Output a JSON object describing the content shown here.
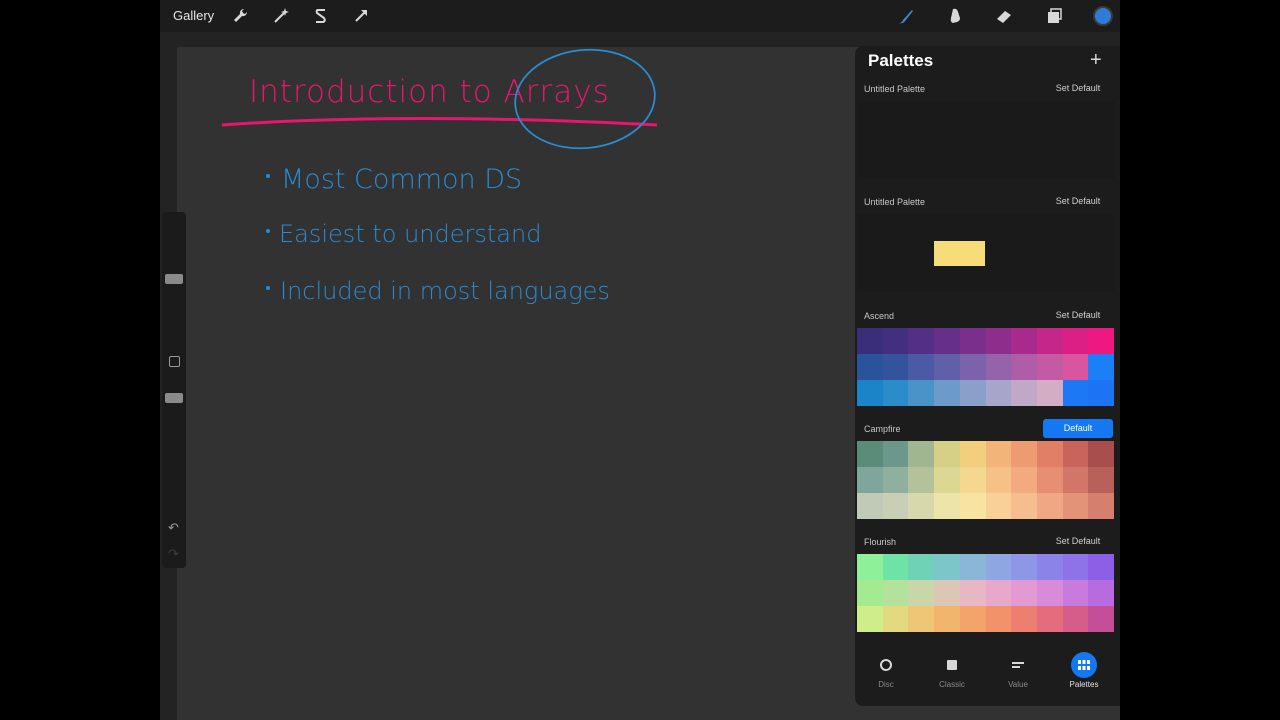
{
  "topbar": {
    "gallery_label": "Gallery",
    "left_icons": [
      "wrench-icon",
      "magic-wand-icon",
      "selection-s-icon",
      "arrow-icon"
    ],
    "right_icons": [
      "brush-icon",
      "smudge-icon",
      "eraser-icon",
      "layers-icon",
      "color-circle-icon"
    ],
    "color_circle": "#2f7bd6"
  },
  "canvas": {
    "title": "Introduction to Arrays",
    "title_color": "#e8166f",
    "highlight_color": "#2a8bd0",
    "bullet_color": "#2a8bd0",
    "bullets": [
      "Most Common DS",
      "Easiest to understand",
      "Included in most languages"
    ]
  },
  "palettes_panel": {
    "title": "Palettes",
    "add_icon": "plus-icon",
    "palettes": [
      {
        "name": "Untitled Palette",
        "button": "Set Default",
        "is_default": false,
        "swatches": []
      },
      {
        "name": "Untitled Palette",
        "button": "Set Default",
        "is_default": false,
        "swatches": [
          "#f7dc7a"
        ]
      },
      {
        "name": "Ascend",
        "button": "Set Default",
        "is_default": false,
        "swatches": [
          "#3a2d7a",
          "#432f7f",
          "#532f85",
          "#66308a",
          "#7a2f8c",
          "#8f2d8c",
          "#a82a8c",
          "#c4268a",
          "#db1f85",
          "#ee1883",
          "#29539a",
          "#34539d",
          "#4a5aa4",
          "#6060a8",
          "#7c62aa",
          "#9463a9",
          "#ad5ea6",
          "#c55aa4",
          "#da55a0",
          "#1c7ff5",
          "#1b83c7",
          "#2a8cc9",
          "#4a93c9",
          "#6c9bcb",
          "#8b9fcb",
          "#a8a5ca",
          "#c0a8c7",
          "#d3adc4",
          "#1c78f5",
          "#1c74f5"
        ]
      },
      {
        "name": "Campfire",
        "button": "Default",
        "is_default": true,
        "swatches": [
          "#5b8c7a",
          "#6b988a",
          "#9fb690",
          "#d6cf86",
          "#f2cf7d",
          "#f3b47a",
          "#ee9b72",
          "#e07e66",
          "#c8645b",
          "#a84f4e",
          "#7fa69a",
          "#8fb09c",
          "#b3c29a",
          "#dcd793",
          "#f5d890",
          "#f5c186",
          "#f2aa7e",
          "#e68f72",
          "#d27767",
          "#b8615b",
          "#c1c9b7",
          "#c9cfb4",
          "#d8d8ad",
          "#ece4a8",
          "#f8e3a3",
          "#f8d098",
          "#f6bd8f",
          "#ef a883",
          "#e39478",
          "#d5806f"
        ]
      },
      {
        "name": "Flourish",
        "button": "Set Default",
        "is_default": false,
        "swatches": [
          "#8ff09a",
          "#6fe2a6",
          "#6fd2b6",
          "#7cc5c9",
          "#8ab7d8",
          "#8ea7e2",
          "#8e96e6",
          "#8b83e8",
          "#8d72e8",
          "#8c5fe6",
          "#a4ea90",
          "#b5e29a",
          "#c9d6a7",
          "#dcc7b7",
          "#e9b7c4",
          "#e8a8cc",
          "#e39ad2",
          "#d98ad8",
          "#c97add",
          "#b86ae0",
          "#d0ed8c",
          "#e2d980",
          "#eec676",
          "#f2b56e",
          "#f3a46a",
          "#f2926b",
          "#ed7f71",
          "#e46c7c",
          "#d65c89",
          "#c54e98"
        ]
      }
    ]
  },
  "bottom_nav": [
    {
      "label": "Disc",
      "icon": "disc-icon",
      "active": false
    },
    {
      "label": "Classic",
      "icon": "classic-square-icon",
      "active": false
    },
    {
      "label": "Value",
      "icon": "value-sliders-icon",
      "active": false
    },
    {
      "label": "Palettes",
      "icon": "palettes-grid-icon",
      "active": true
    }
  ]
}
